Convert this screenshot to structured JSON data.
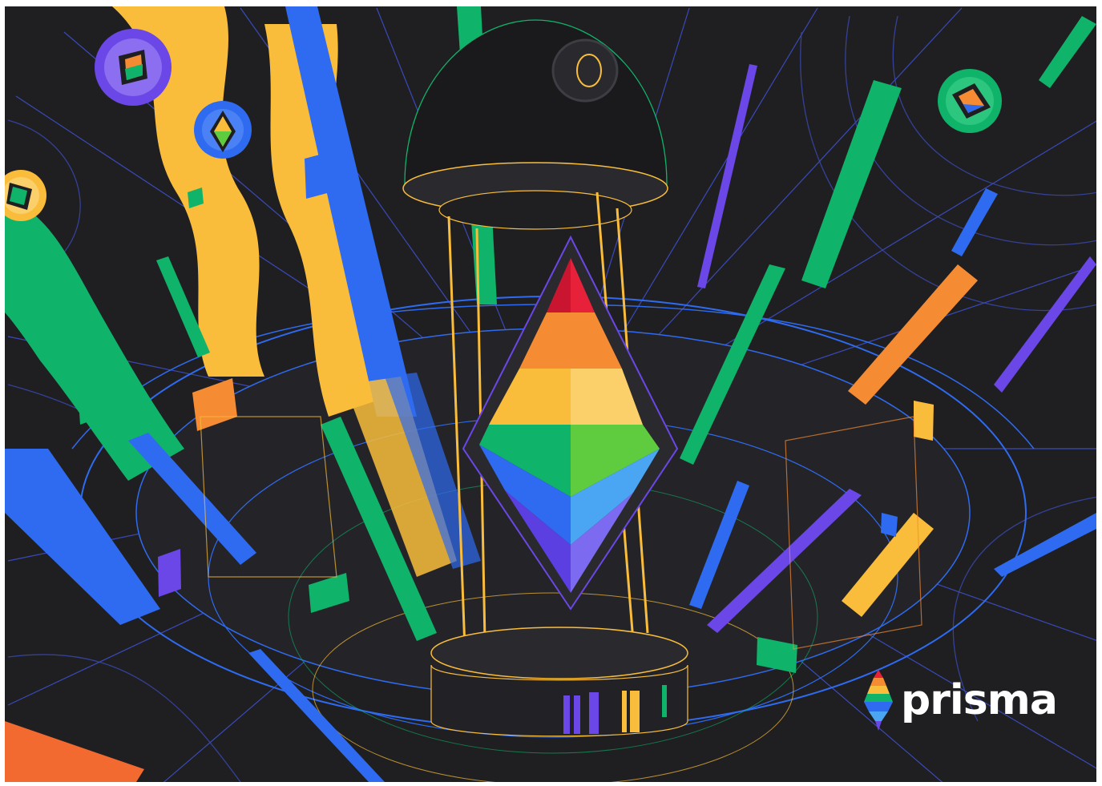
{
  "illustration": {
    "subject": "rainbow-diamond-hourglass-illustration",
    "background_color": "#1f1f21",
    "palette": {
      "red": "#e8213b",
      "orange": "#f58b33",
      "yellow": "#f9bd3b",
      "green": "#10b36a",
      "blue": "#2f6bf0",
      "purple": "#6a47e6",
      "lime": "#5fcc3f",
      "sky": "#4aa6f2"
    }
  },
  "brand": {
    "name": "prisma",
    "logo_icon": "rainbow-diamond-icon"
  }
}
